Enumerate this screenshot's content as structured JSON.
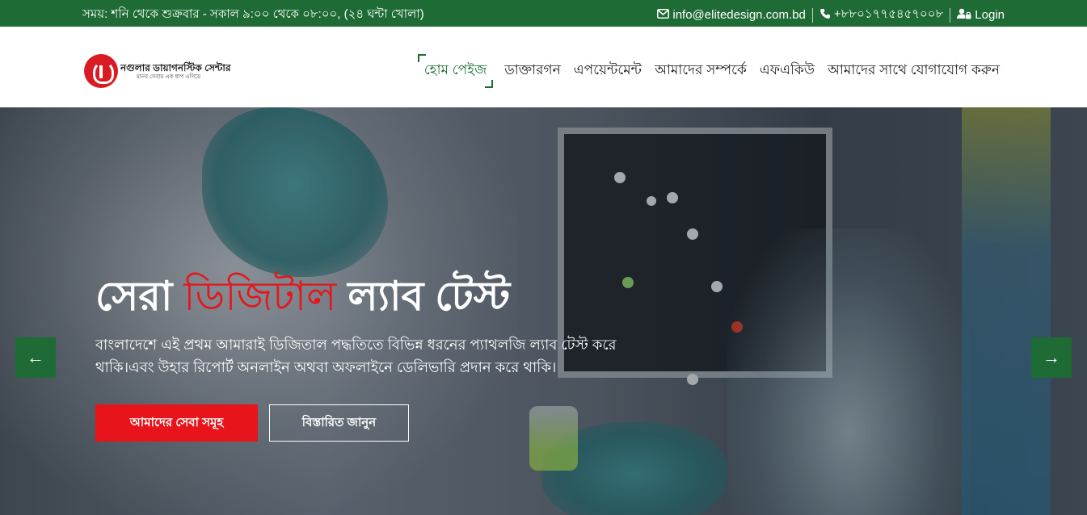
{
  "topbar": {
    "hours": "সময়: শনি থেকে শুক্রবার - সকাল ৯:০০ থেকে ০৮:০০, (২৪ ঘন্টা খোলা)",
    "email": "info@elitedesign.com.bd",
    "phone": "+৮৮০১৭৭৫৪৫৭০০৮",
    "login": "Login",
    "email_icon": "envelope-icon",
    "phone_icon": "phone-icon",
    "login_icon": "user-lock-icon"
  },
  "logo": {
    "name": "নগুলার ডায়াগনস্টিক সেন্টার",
    "tagline": "মানব সেবায় এক ধাপ এগিয়ে"
  },
  "nav": {
    "items": [
      {
        "label": "হোম পেইজ",
        "active": true
      },
      {
        "label": "ডাক্তারগন"
      },
      {
        "label": "এপয়েন্টমেন্ট"
      },
      {
        "label": "আমাদের সম্পর্কে"
      },
      {
        "label": "এফএকিউ"
      },
      {
        "label": "আমাদের সাথে যোগাযোগ করুন"
      }
    ]
  },
  "hero": {
    "title_part1": "সেরা ",
    "title_highlight": "ডিজিটাল",
    "title_part2": " ল্যাব টেস্ট",
    "description": "বাংলাদেশে এই প্রথম আমারাই ডিজিতাল পদ্ধতিতে বিভিন্ন ধরনের প্যাথলজি ল্যাব টেস্ট করে থাকি।এবং উহার রিপোর্ট অনলাইন অথবা অফলাইনে ডেলিভারি প্রদান করে থাকি।",
    "primary_button": "আমাদের সেবা সমূহ",
    "secondary_button": "বিস্তারিত জানুন",
    "prev_arrow": "←",
    "next_arrow": "→"
  },
  "colors": {
    "brand_green": "#1e6b35",
    "accent_red": "#e8141b"
  }
}
